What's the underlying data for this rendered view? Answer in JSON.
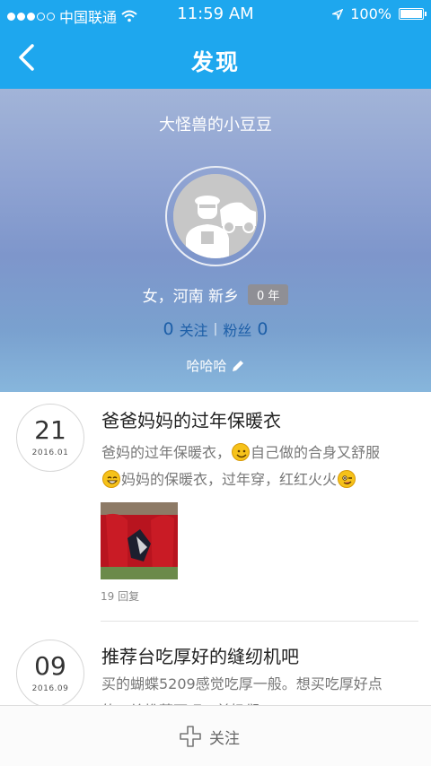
{
  "status_bar": {
    "carrier": "中国联通",
    "time": "11:59 AM",
    "battery": "100%",
    "signal_dots_filled": 3,
    "signal_dots_total": 5
  },
  "nav": {
    "title": "发现",
    "back_icon": "chevron-left-icon"
  },
  "profile": {
    "name": "大怪兽的小豆豆",
    "gender_location": "女，河南 新乡",
    "years_badge": "0 年",
    "following_count": "0",
    "following_label": "关注",
    "fans_label": "粉丝",
    "fans_count": "0",
    "separator": "|",
    "signature": "哈哈哈",
    "edit_icon": "pencil-icon",
    "avatar_icon": "default-avatar-icon",
    "header_colors": [
      "#a2b4d8",
      "#7e96cb",
      "#87b6dc"
    ]
  },
  "posts": [
    {
      "day": "21",
      "year_month": "2016.01",
      "title": "爸爸妈妈的过年保暖衣",
      "body_line1_a": "爸妈的过年保暖衣，",
      "body_line1_b": "自己做的合身又舒服",
      "body_line2_a": "妈妈的保暖衣，过年穿，红红火火",
      "replies": "19 回复",
      "has_image": true
    },
    {
      "day": "09",
      "year_month": "2016.09",
      "title": "推荐台吃厚好的缝纫机吧",
      "body_line1": "买的蝴蝶5209感觉吃厚一般。想买吃厚好点",
      "body_line2": "的，给推荐下吧，兼奶们"
    }
  ],
  "bottom_bar": {
    "follow_label": "关注",
    "follow_icon": "plus-icon"
  },
  "colors": {
    "accent": "#1ea7ee",
    "counts_text": "#1d5fa8",
    "badge_bg": "#8f8f95"
  }
}
